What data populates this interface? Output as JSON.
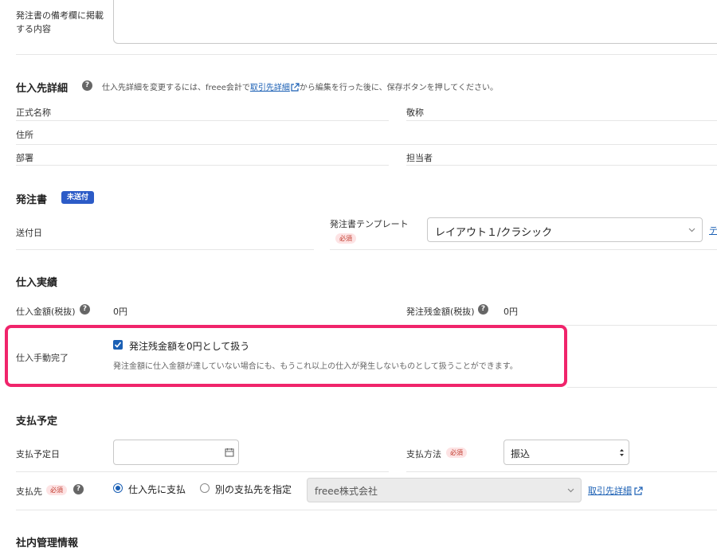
{
  "notes": {
    "label": "発注書の備考欄に掲載する内容"
  },
  "supplier": {
    "title": "仕入先詳細",
    "help_pre": "仕入先詳細を変更するには、freee会計で",
    "help_link": "取引先詳細",
    "help_post": "から編集を行った後に、保存ボタンを押してください。",
    "official_name_label": "正式名称",
    "honorific_label": "敬称",
    "address_label": "住所",
    "department_label": "部署",
    "person_label": "担当者"
  },
  "po": {
    "title": "発注書",
    "status_badge": "未送付",
    "sent_date_label": "送付日",
    "template_label": "発注書テンプレート",
    "required": "必須",
    "template_value": "レイアウト１/クラシック",
    "edge_link": "テ"
  },
  "results": {
    "title": "仕入実績",
    "amount_label": "仕入金額(税抜)",
    "amount_value": "0円",
    "remaining_label": "発注残金額(税抜)",
    "remaining_value": "0円",
    "manual_label": "仕入手動完了",
    "checkbox_label": "発注残金額を0円として扱う",
    "checkbox_checked": true,
    "checkbox_desc": "発注金額に仕入金額が達していない場合にも、もうこれ以上の仕入が発生しないものとして扱うことができます。",
    "highlight_color": "#f0246b"
  },
  "payment": {
    "title": "支払予定",
    "date_label": "支払予定日",
    "date_value": "",
    "method_label": "支払方法",
    "required": "必須",
    "method_value": "振込",
    "payee_label": "支払先",
    "radio_supplier": "仕入先に支払",
    "radio_other": "別の支払先を指定",
    "payee_value": "freee株式会社",
    "detail_link": "取引先詳細"
  },
  "internal": {
    "title": "社内管理情報"
  }
}
